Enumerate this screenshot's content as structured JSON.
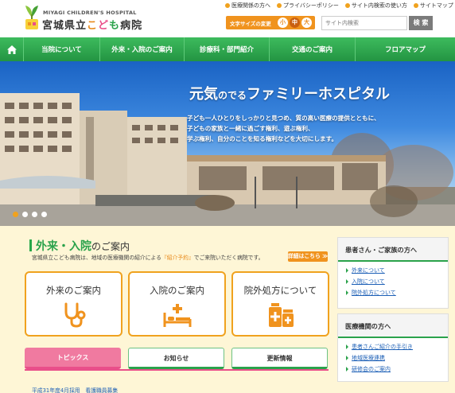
{
  "header": {
    "logo_en": "MIYAGI CHILDREN'S HOSPITAL",
    "logo_ja_pre": "宮城県立",
    "logo_ja_acc1": "こ",
    "logo_ja_acc2": "ど",
    "logo_ja_acc3": "も",
    "logo_ja_post": "病院",
    "utility_links": [
      "医療関係の方へ",
      "プライバシーポリシー",
      "サイト内検索の使い方",
      "サイトマップ"
    ],
    "font_size_label": "文字サイズの変更",
    "font_sizes": [
      "小",
      "中",
      "大"
    ],
    "search_placeholder": "サイト内検索",
    "search_button": "検 索"
  },
  "nav": {
    "home_icon": "home-icon",
    "items": [
      "当院について",
      "外来・入院のご案内",
      "診療科・部門紹介",
      "交通のご案内",
      "フロアマップ"
    ]
  },
  "hero": {
    "title_a": "元気",
    "title_b": "のでる",
    "title_c": "ファミリーホスピタル",
    "lines": [
      "子ども一人ひとりをしっかりと見つめ、質の高い医療の提供とともに、",
      "子どもの家族と一緒に過ごす権利、遊ぶ権利、",
      "学ぶ権利、自分のことを知る権利などを大切にします。"
    ]
  },
  "section": {
    "heading_a": "外来・入院",
    "heading_b": "のご案内",
    "desc_a": "宮城県立こども病院は、地域の医療機関の紹介による",
    "desc_b": "『紹介予約』",
    "desc_c": "でご来院いただく病院です。",
    "details_button": "詳細はこちら ≫",
    "cards": [
      {
        "label": "外来のご案内",
        "icon": "stethoscope-icon"
      },
      {
        "label": "入院のご案内",
        "icon": "hospital-bed-icon"
      },
      {
        "label": "院外処方について",
        "icon": "medicine-icon"
      }
    ],
    "tabs": [
      "トピックス",
      "お知らせ",
      "更新情報"
    ],
    "news_item": "平成31年度4月採用　看護職員募集"
  },
  "sidebar": {
    "patients_header": "患者さん・ご家族の方へ",
    "patients_links": [
      "外来について",
      "入院について",
      "院外処方について"
    ],
    "institutions_header": "医療機関の方へ",
    "institutions_links": [
      "患者さんご紹介の手引き",
      "地域医療連携",
      "研修会のご案内"
    ]
  },
  "colors": {
    "nav_green": "#2aa24b",
    "accent_orange": "#f0931e",
    "pink": "#e94f8a",
    "link_blue": "#1c5fb6"
  }
}
